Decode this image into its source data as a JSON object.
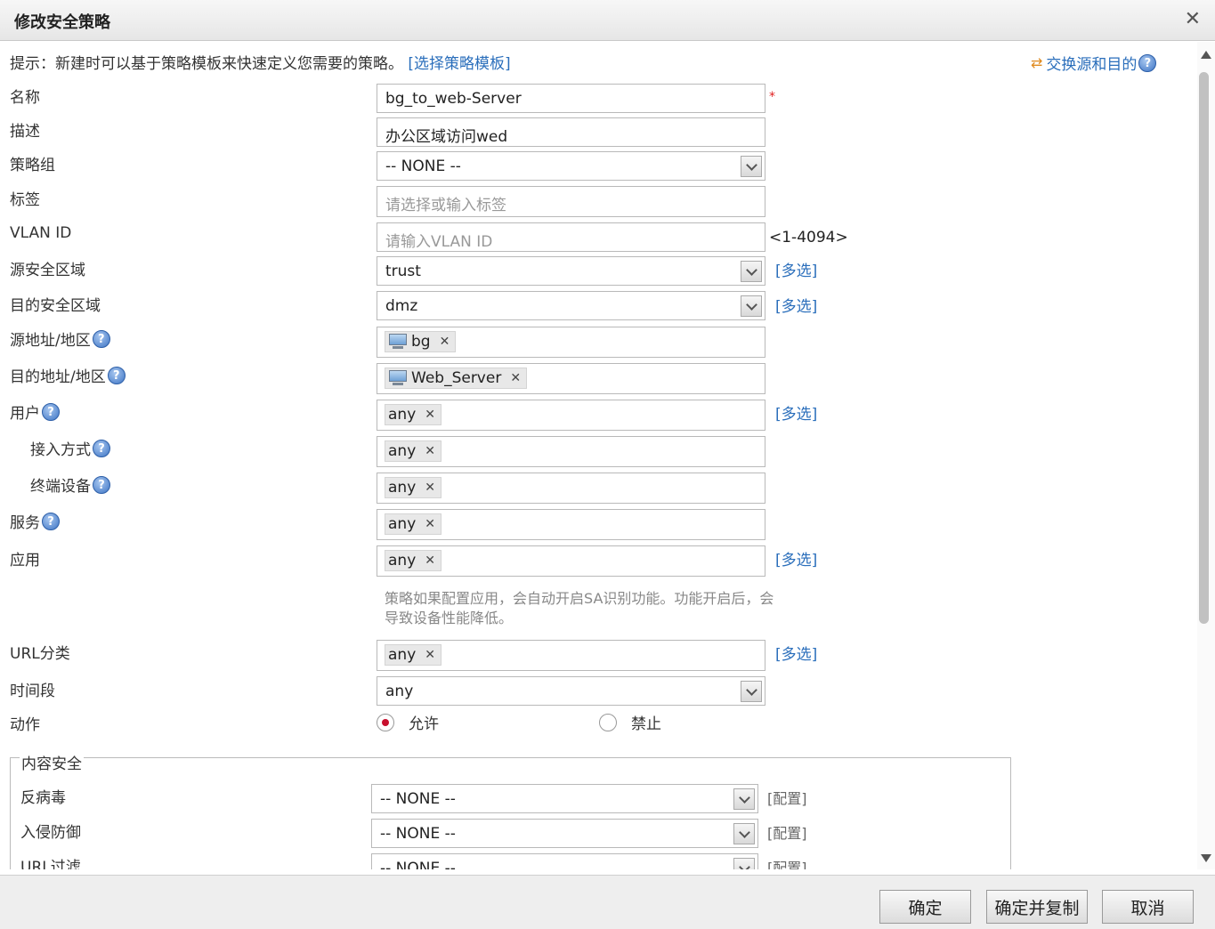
{
  "dialog": {
    "title": "修改安全策略"
  },
  "tip": {
    "text": "提示：新建时可以基于策略模板来快速定义您需要的策略。",
    "link": "[选择策略模板]"
  },
  "swap_label": "交换源和目的",
  "help_glyph": "?",
  "remove_glyph": "✕",
  "fields": {
    "name": {
      "label": "名称",
      "value": "bg_to_web-Server",
      "required_mark": "*"
    },
    "description": {
      "label": "描述",
      "value": "办公区域访问wed"
    },
    "policy_group": {
      "label": "策略组",
      "value": "-- NONE --"
    },
    "tags": {
      "label": "标签",
      "placeholder": "请选择或输入标签"
    },
    "vlan_id": {
      "label": "VLAN ID",
      "placeholder": "请输入VLAN ID",
      "hint": "<1-4094>"
    },
    "src_zone": {
      "label": "源安全区域",
      "value": "trust",
      "multi": "[多选]"
    },
    "dst_zone": {
      "label": "目的安全区域",
      "value": "dmz",
      "multi": "[多选]"
    },
    "src_addr": {
      "label": "源地址/地区",
      "chip": "bg"
    },
    "dst_addr": {
      "label": "目的地址/地区",
      "chip": "Web_Server"
    },
    "user": {
      "label": "用户",
      "chip": "any",
      "multi": "[多选]"
    },
    "access_mode": {
      "label": "接入方式",
      "chip": "any"
    },
    "terminal": {
      "label": "终端设备",
      "chip": "any"
    },
    "service": {
      "label": "服务",
      "chip": "any"
    },
    "application": {
      "label": "应用",
      "chip": "any",
      "multi": "[多选]",
      "note": "策略如果配置应用，会自动开启SA识别功能。功能开启后，会导致设备性能降低。"
    },
    "url_category": {
      "label": "URL分类",
      "chip": "any",
      "multi": "[多选]"
    },
    "time_range": {
      "label": "时间段",
      "value": "any"
    },
    "action": {
      "label": "动作",
      "allow": "允许",
      "deny": "禁止",
      "selected": "允许"
    }
  },
  "content_security": {
    "legend": "内容安全",
    "antivirus": {
      "label": "反病毒",
      "value": "-- NONE --",
      "config": "[配置]"
    },
    "ips": {
      "label": "入侵防御",
      "value": "-- NONE --",
      "config": "[配置]"
    },
    "url_filter": {
      "label": "URL过滤",
      "value": "-- NONE --",
      "config": "[配置]"
    }
  },
  "buttons": {
    "ok": "确定",
    "ok_copy": "确定并复制",
    "cancel": "取消"
  },
  "colors": {
    "link": "#2a6ebb",
    "required": "#e02020",
    "radio_selected": "#c8102e"
  }
}
